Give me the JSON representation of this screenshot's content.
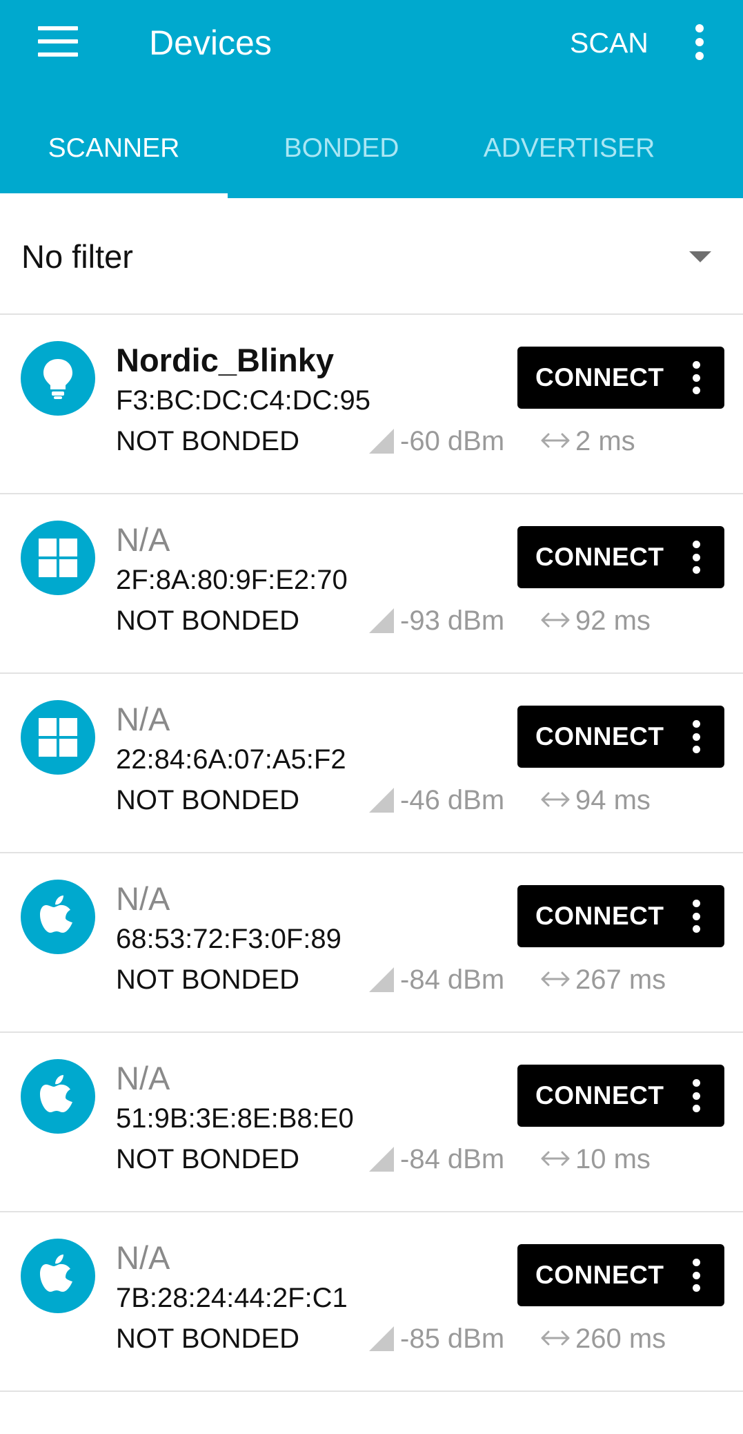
{
  "appbar": {
    "title": "Devices",
    "scan_label": "SCAN",
    "tabs": [
      {
        "label": "SCANNER",
        "active": true
      },
      {
        "label": "BONDED",
        "active": false
      },
      {
        "label": "ADVERTISER",
        "active": false
      }
    ]
  },
  "filter": {
    "selected": "No filter"
  },
  "connect_label": "CONNECT",
  "devices": [
    {
      "icon": "lightbulb-icon",
      "name": "Nordic_Blinky",
      "address": "F3:BC:DC:C4:DC:95",
      "bond": "NOT BONDED",
      "rssi": "-60 dBm",
      "interval": "2 ms"
    },
    {
      "icon": "windows-icon",
      "name": "N/A",
      "address": "2F:8A:80:9F:E2:70",
      "bond": "NOT BONDED",
      "rssi": "-93 dBm",
      "interval": "92 ms"
    },
    {
      "icon": "windows-icon",
      "name": "N/A",
      "address": "22:84:6A:07:A5:F2",
      "bond": "NOT BONDED",
      "rssi": "-46 dBm",
      "interval": "94 ms"
    },
    {
      "icon": "apple-icon",
      "name": "N/A",
      "address": "68:53:72:F3:0F:89",
      "bond": "NOT BONDED",
      "rssi": "-84 dBm",
      "interval": "267 ms"
    },
    {
      "icon": "apple-icon",
      "name": "N/A",
      "address": "51:9B:3E:8E:B8:E0",
      "bond": "NOT BONDED",
      "rssi": "-84 dBm",
      "interval": "10 ms"
    },
    {
      "icon": "apple-icon",
      "name": "N/A",
      "address": "7B:28:24:44:2F:C1",
      "bond": "NOT BONDED",
      "rssi": "-85 dBm",
      "interval": "260 ms"
    }
  ],
  "colors": {
    "accent": "#00a9ce",
    "button": "#000000",
    "secondary_text": "#9a9a9a"
  }
}
